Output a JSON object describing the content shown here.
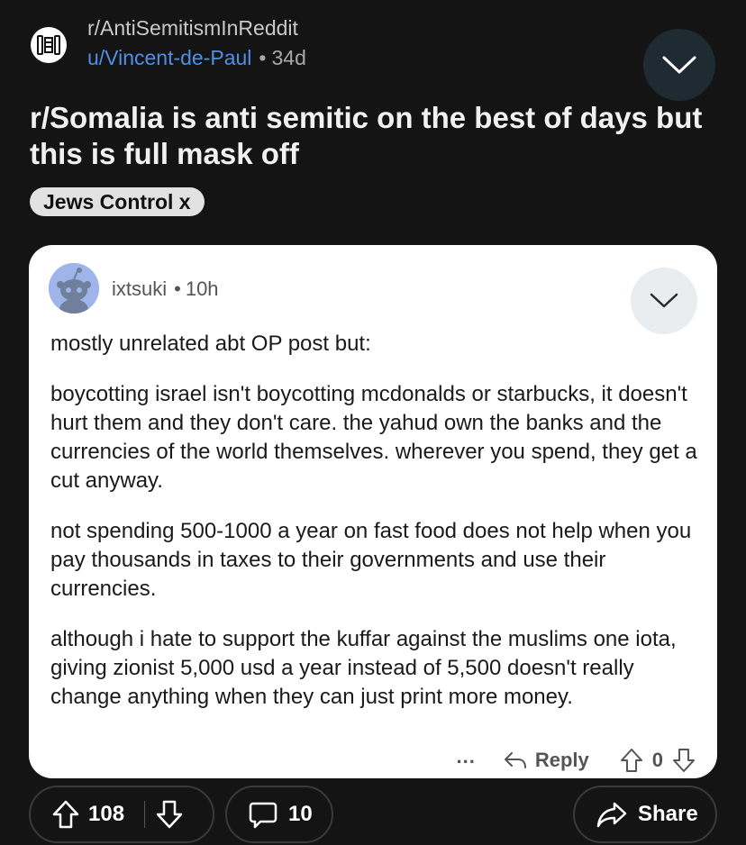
{
  "header": {
    "subreddit": "r/AntiSemitismInReddit",
    "author": "u/Vincent-de-Paul",
    "separator": "•",
    "age": "34d"
  },
  "post": {
    "title": "r/Somalia is anti semitic on the best of days but this is full mask off",
    "flair": "Jews Control x"
  },
  "comment": {
    "username": "ixtsuki",
    "separator": "•",
    "age": "10h",
    "paragraphs": [
      "mostly unrelated abt OP post but:",
      "boycotting israel isn't boycotting mcdonalds or starbucks, it doesn't hurt them and they don't care. the yahud own the banks and the currencies of the world themselves. wherever you spend, they get a cut anyway.",
      "not spending 500-1000 a year on fast food does not help when you pay thousands in taxes to their governments and use their currencies.",
      "although i hate to support the kuffar against the muslims one iota, giving zionist 5,000 usd a year instead of 5,500 doesn't really change anything when they can just print more money."
    ],
    "more_label": "...",
    "reply_label": "Reply",
    "vote_count": "0"
  },
  "actions": {
    "vote_count": "108",
    "comment_count": "10",
    "share_label": "Share"
  },
  "colors": {
    "background": "#141414",
    "author_link": "#4f8fe6",
    "card": "#ffffff",
    "flair": "#e2e2e2",
    "collapse_button": "#1f2b33"
  },
  "icons": {
    "subreddit": "subreddit-icon",
    "collapse": "chevron-down-icon",
    "reply": "reply-arrow-icon",
    "upvote": "upvote-arrow-icon",
    "downvote": "downvote-arrow-icon",
    "comments": "comment-bubble-icon",
    "share": "share-arrow-icon"
  }
}
